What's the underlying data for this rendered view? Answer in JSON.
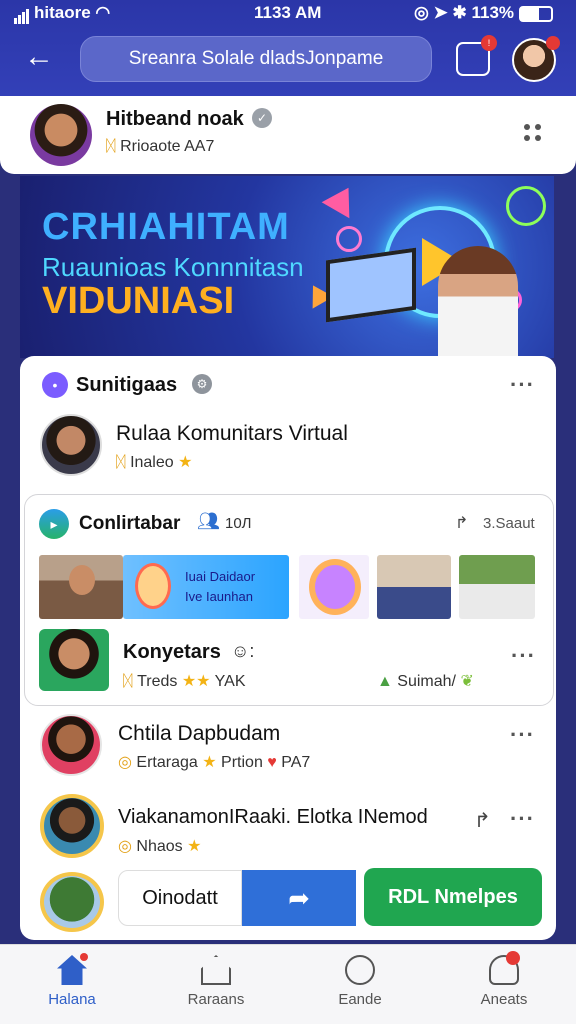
{
  "status_bar": {
    "carrier": "hitaore",
    "time": "1133 AM",
    "battery": "113%"
  },
  "header": {
    "search_text": "Sreanra Solale dladsJonpame"
  },
  "profile": {
    "name": "Hitbeand noak",
    "subtitle": "Rrioaote AA7"
  },
  "banner": {
    "line1": "CRHIAHITAM",
    "line2": "Ruaunioas Konnnitasn",
    "line3": "VIDUNIASI"
  },
  "group": {
    "title": "Sunitigaas",
    "community_name": "Rulaa Komunitars Virtual",
    "community_sub": "Inaleo"
  },
  "conversation": {
    "title": "Conlirtabar",
    "count": "10Л",
    "share_label": "3.Saaut",
    "thumb_text": [
      "Iuai Daidaor",
      "Ive Iaunhan"
    ],
    "name": "Konyetars",
    "tags": "Treds",
    "tags_suffix": "YAK",
    "summary": "Suimah/"
  },
  "items": [
    {
      "name": "Chtila Dapbudam",
      "sub_a": "Ertaraga",
      "sub_b": "Prtion",
      "sub_c": "PA7"
    },
    {
      "name": "ViakanamonIRaaki. Elotka INemod",
      "sub_a": "Nhaos"
    }
  ],
  "actions": {
    "primary": "Oinodatt",
    "secondary": "RDL Nmelpes"
  },
  "nav": {
    "tabs": [
      {
        "label": "Halana"
      },
      {
        "label": "Raraans"
      },
      {
        "label": "Eande"
      },
      {
        "label": "Aneats"
      }
    ]
  },
  "colors": {
    "header": "#3340b8",
    "accent": "#2f6fd8",
    "green": "#20a650",
    "badge": "#e53935"
  },
  "icons": [
    "back-arrow-icon",
    "share-icon",
    "verified-icon",
    "grip-icon",
    "more-icon",
    "people-icon",
    "star-icon",
    "heart-icon",
    "home-icon",
    "store-icon",
    "chat-icon",
    "user-icon"
  ]
}
